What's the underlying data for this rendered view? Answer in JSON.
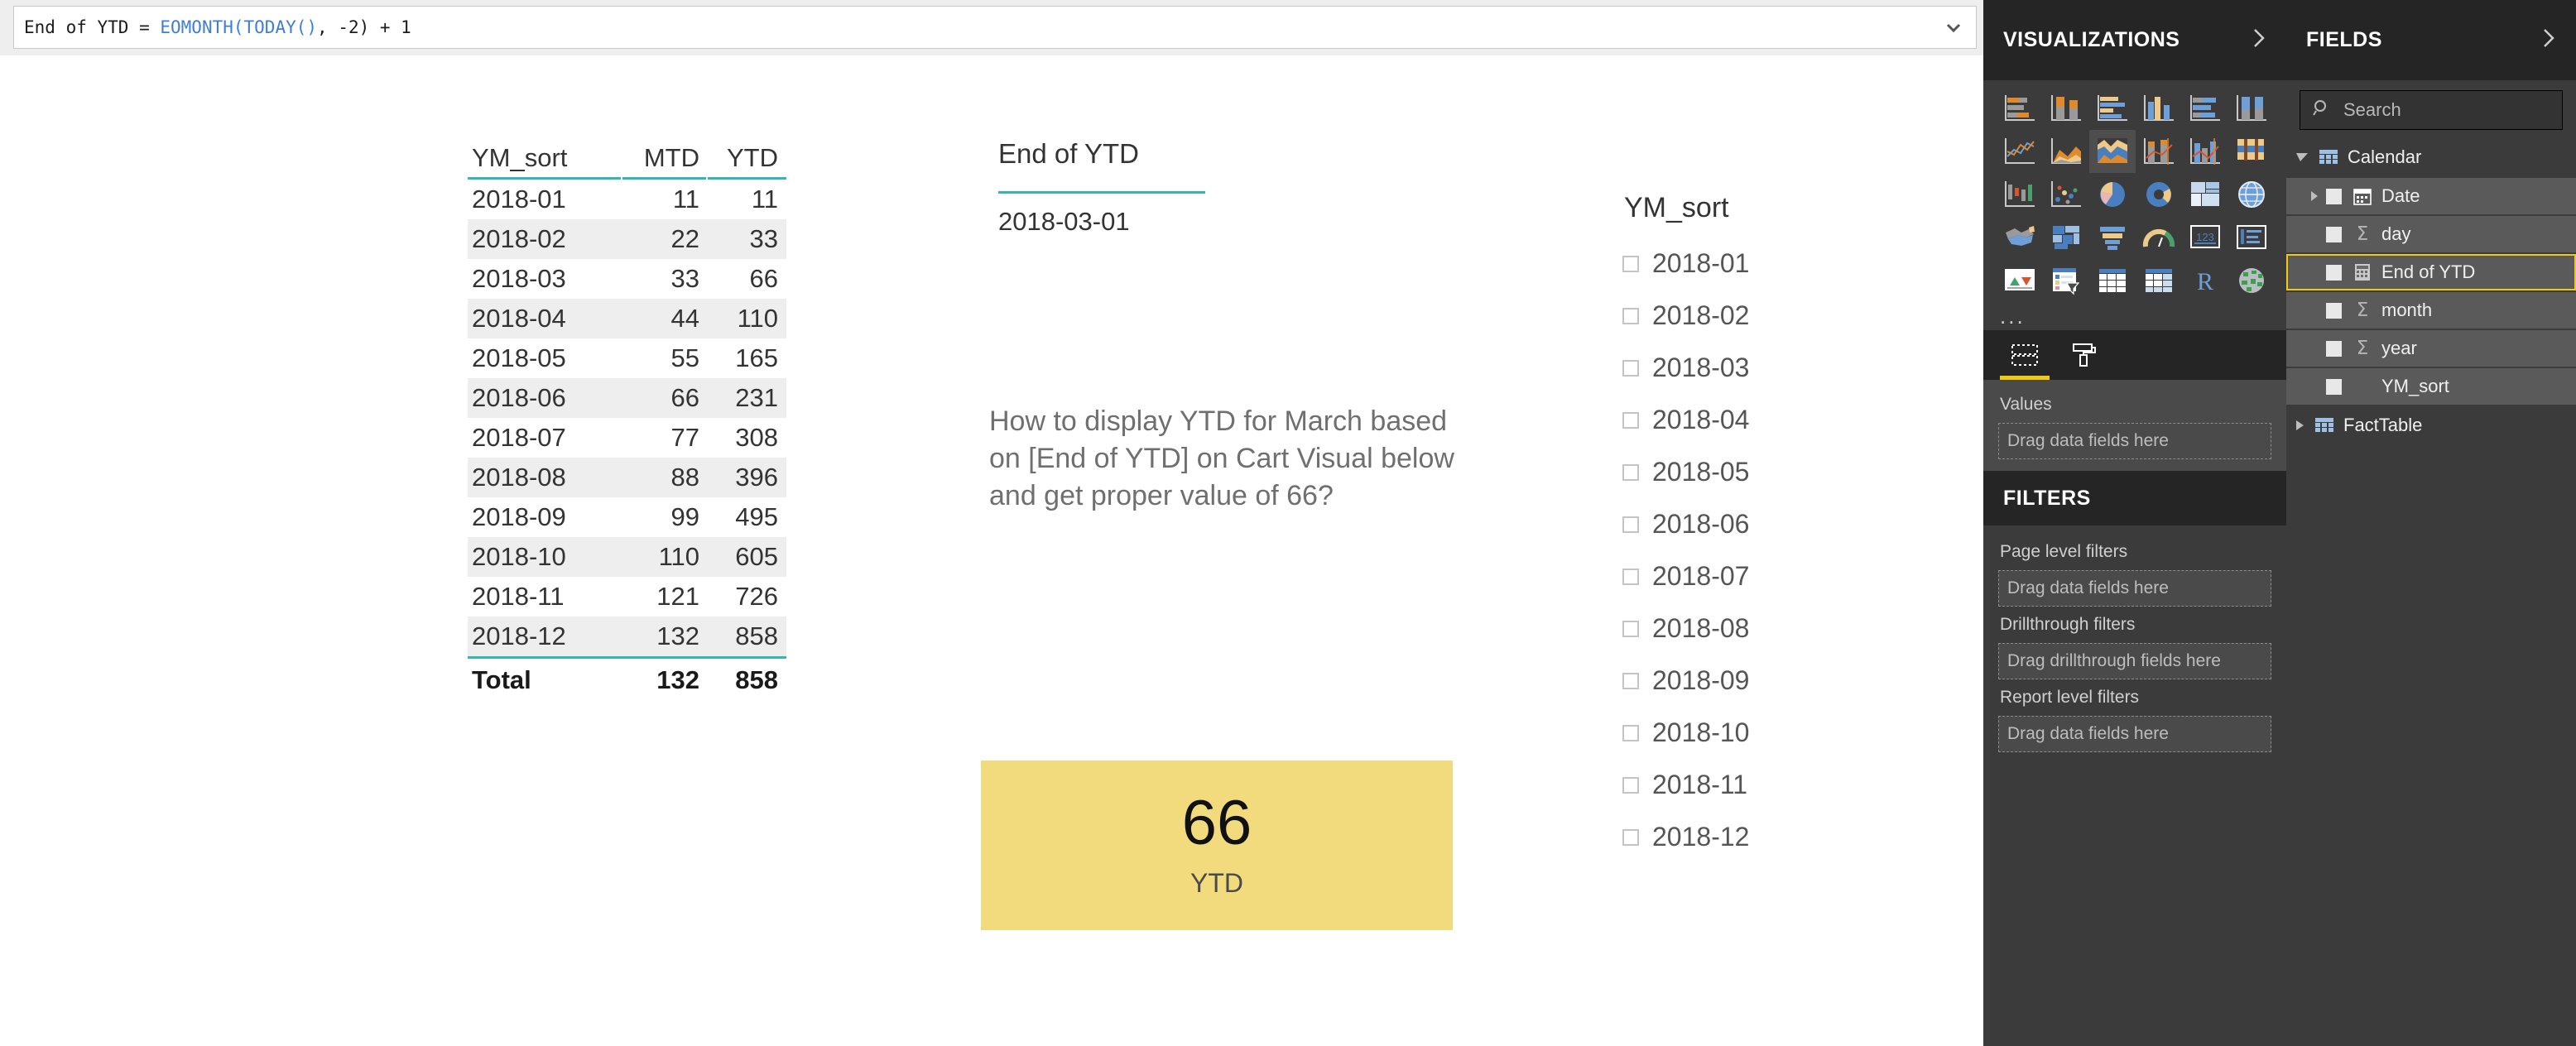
{
  "formula_bar": {
    "prefix": "End of YTD = ",
    "function_part": "EOMONTH(TODAY()",
    "suffix": ", -2) + 1",
    "full": "End of YTD = EOMONTH(TODAY(), -2) + 1",
    "chevron_icon": "chevron-down-icon"
  },
  "matrix": {
    "columns": [
      "YM_sort",
      "MTD",
      "YTD"
    ],
    "rows": [
      {
        "ym": "2018-01",
        "mtd": "11",
        "ytd": "11"
      },
      {
        "ym": "2018-02",
        "mtd": "22",
        "ytd": "33"
      },
      {
        "ym": "2018-03",
        "mtd": "33",
        "ytd": "66"
      },
      {
        "ym": "2018-04",
        "mtd": "44",
        "ytd": "110"
      },
      {
        "ym": "2018-05",
        "mtd": "55",
        "ytd": "165"
      },
      {
        "ym": "2018-06",
        "mtd": "66",
        "ytd": "231"
      },
      {
        "ym": "2018-07",
        "mtd": "77",
        "ytd": "308"
      },
      {
        "ym": "2018-08",
        "mtd": "88",
        "ytd": "396"
      },
      {
        "ym": "2018-09",
        "mtd": "99",
        "ytd": "495"
      },
      {
        "ym": "2018-10",
        "mtd": "110",
        "ytd": "605"
      },
      {
        "ym": "2018-11",
        "mtd": "121",
        "ytd": "726"
      },
      {
        "ym": "2018-12",
        "mtd": "132",
        "ytd": "858"
      }
    ],
    "total": {
      "label": "Total",
      "mtd": "132",
      "ytd": "858"
    },
    "accent_color": "#35b6b4"
  },
  "eoytd_card": {
    "title": "End of YTD",
    "value": "2018-03-01"
  },
  "question": {
    "text": "How to display YTD for March based on [End of YTD] on Cart Visual below and get proper value of 66?"
  },
  "yellow_card": {
    "value": "66",
    "label": "YTD",
    "background_color": "#f2db7c"
  },
  "slicer": {
    "title": "YM_sort",
    "items": [
      "2018-01",
      "2018-02",
      "2018-03",
      "2018-04",
      "2018-05",
      "2018-06",
      "2018-07",
      "2018-08",
      "2018-09",
      "2018-10",
      "2018-11",
      "2018-12"
    ]
  },
  "visualizations": {
    "header": "VISUALIZATIONS",
    "chevron_icon": "chevron-right-icon",
    "more_icon": "ellipsis-icon",
    "more_label": "...",
    "icons": [
      "stacked-bar-chart-icon",
      "stacked-column-chart-icon",
      "clustered-bar-chart-icon",
      "clustered-column-chart-icon",
      "100-stacked-bar-chart-icon",
      "100-stacked-column-chart-icon",
      "line-chart-icon",
      "area-chart-icon",
      "stacked-area-chart-icon",
      "line-and-stacked-column-chart-icon",
      "line-and-clustered-column-chart-icon",
      "ribbon-chart-icon",
      "waterfall-chart-icon",
      "scatter-chart-icon",
      "pie-chart-icon",
      "donut-chart-icon",
      "treemap-icon",
      "map-globe-icon",
      "filled-map-icon",
      "shape-map-icon",
      "funnel-chart-icon",
      "gauge-chart-icon",
      "card-number-icon",
      "multi-row-card-icon",
      "kpi-icon",
      "slicer-icon",
      "table-icon",
      "matrix-icon",
      "r-script-visual-icon",
      "arcgis-map-icon"
    ],
    "tabs": [
      {
        "name": "fields-tab",
        "icon": "fields-pane-icon",
        "active": true
      },
      {
        "name": "format-tab",
        "icon": "paint-roller-icon",
        "active": false
      }
    ],
    "wells": {
      "values_label": "Values",
      "values_placeholder": "Drag data fields here"
    },
    "accent_color": "#f2c811"
  },
  "filters": {
    "header": "FILTERS",
    "groups": [
      {
        "label": "Page level filters",
        "placeholder": "Drag data fields here"
      },
      {
        "label": "Drillthrough filters",
        "placeholder": "Drag drillthrough fields here"
      },
      {
        "label": "Report level filters",
        "placeholder": "Drag data fields here"
      }
    ]
  },
  "fields": {
    "header": "FIELDS",
    "chevron_icon": "chevron-right-icon",
    "search_placeholder": "Search",
    "search_icon": "search-icon",
    "tables": [
      {
        "name": "Calendar",
        "expanded": true,
        "icon": "table-icon",
        "fields": [
          {
            "label": "Date",
            "icon": "calendar-icon",
            "expandable": true,
            "selected": false
          },
          {
            "label": "day",
            "icon": "sigma-icon",
            "expandable": false,
            "selected": false
          },
          {
            "label": "End of YTD",
            "icon": "calculator-icon",
            "expandable": false,
            "selected": true
          },
          {
            "label": "month",
            "icon": "sigma-icon",
            "expandable": false,
            "selected": false
          },
          {
            "label": "year",
            "icon": "sigma-icon",
            "expandable": false,
            "selected": false
          },
          {
            "label": "YM_sort",
            "icon": "none",
            "expandable": false,
            "selected": false
          }
        ]
      },
      {
        "name": "FactTable",
        "expanded": false,
        "icon": "table-icon",
        "fields": []
      }
    ]
  }
}
